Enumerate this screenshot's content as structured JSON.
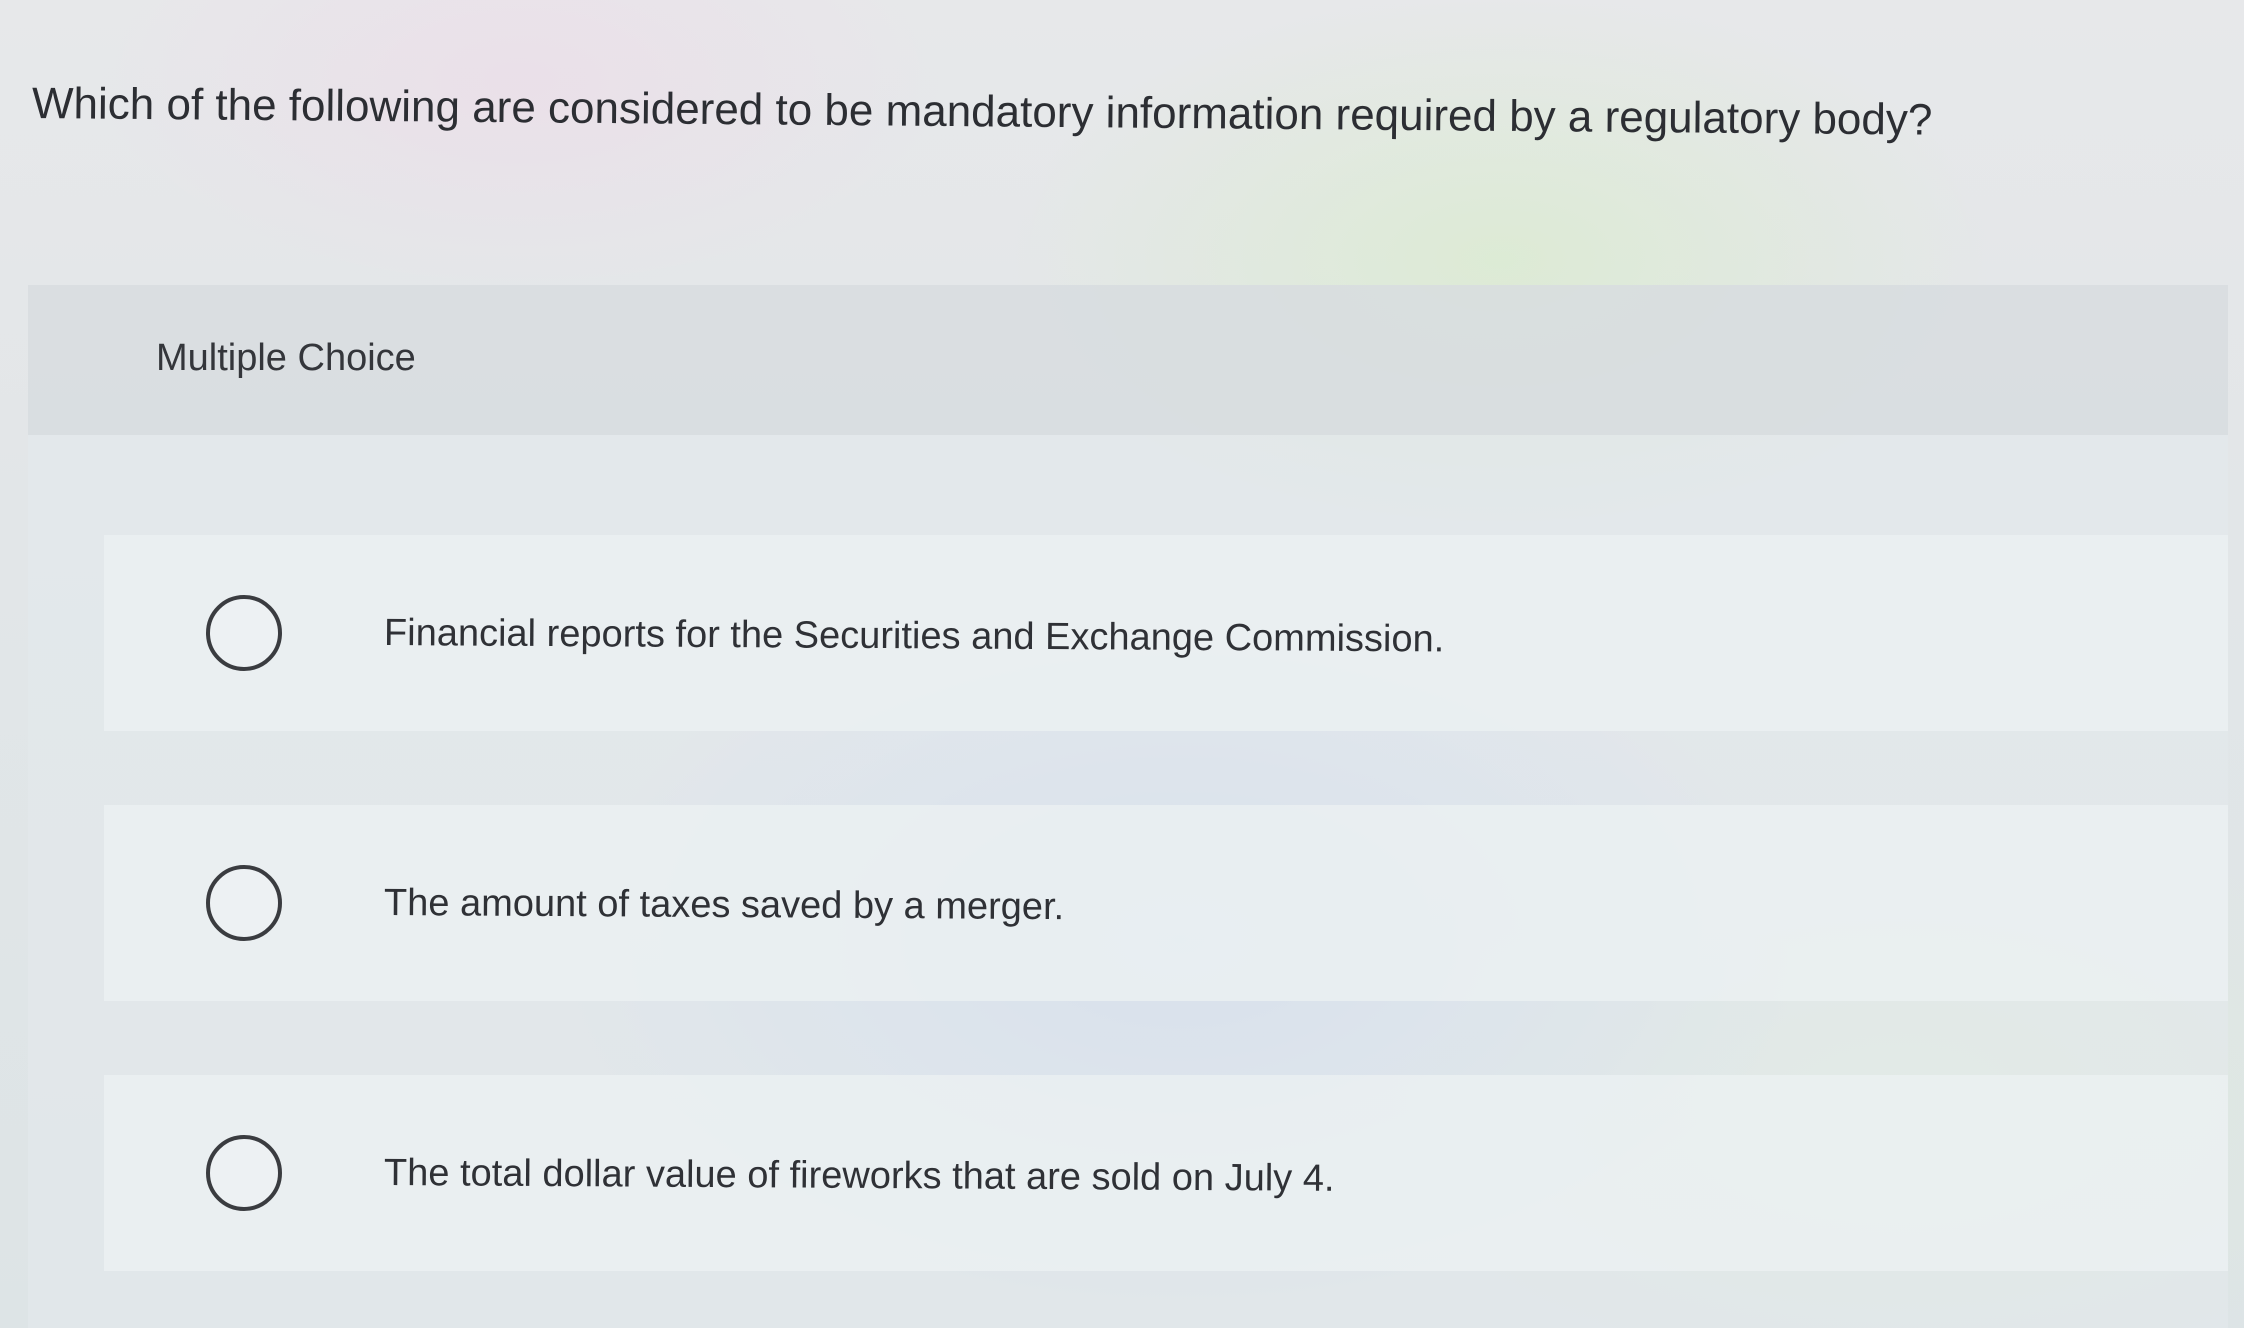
{
  "question": {
    "text": "Which of the following are considered to be mandatory information required by a regulatory body?"
  },
  "panel": {
    "title": "Multiple Choice",
    "options": [
      {
        "label": "Financial reports for the Securities and Exchange Commission.",
        "selected": false
      },
      {
        "label": "The amount of taxes saved by a merger.",
        "selected": false
      },
      {
        "label": "The total dollar value of fireworks that are sold on July 4.",
        "selected": false
      }
    ]
  }
}
